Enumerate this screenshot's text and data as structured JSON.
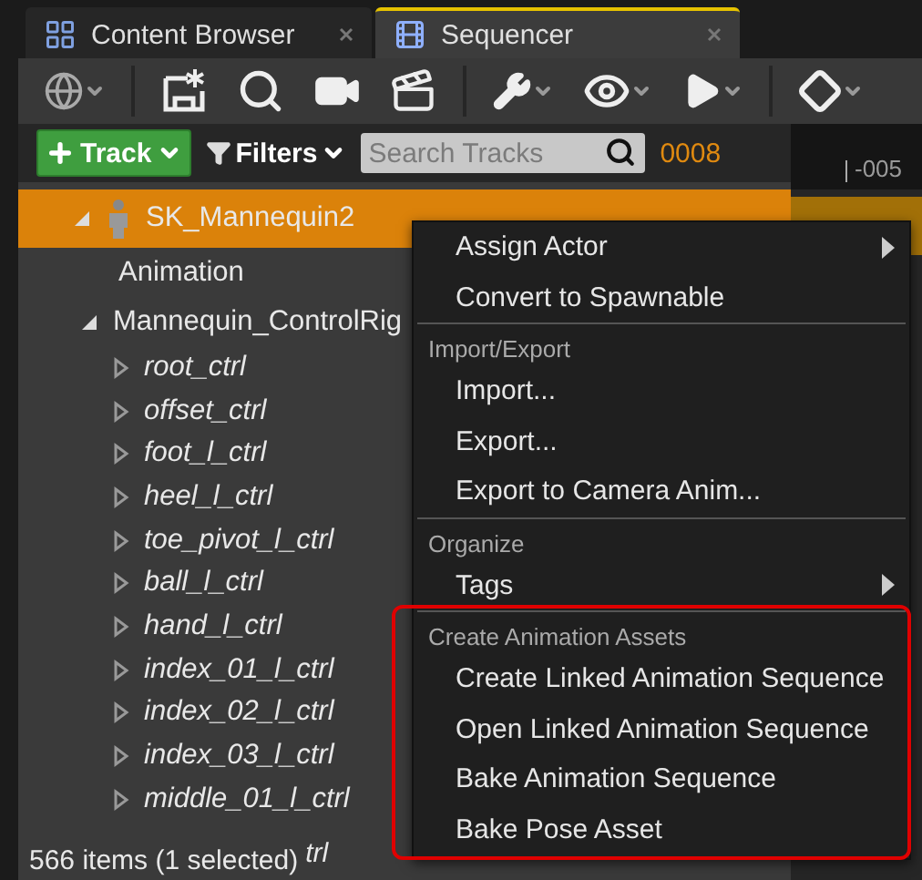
{
  "tabs": [
    {
      "label": "Content Browser",
      "selected": false
    },
    {
      "label": "Sequencer",
      "selected": true
    }
  ],
  "track_bar": {
    "add_button": "Track",
    "filters": "Filters",
    "search": {
      "placeholder": "Search Tracks"
    },
    "frame": "0008"
  },
  "timeline": {
    "tick": "-005"
  },
  "tree": [
    {
      "label": "SK_Mannequin2",
      "selected": true,
      "expanded": true,
      "italic": false,
      "children": [
        {
          "label": "Animation",
          "selected": false,
          "italic": false
        },
        {
          "label": "Mannequin_ControlRig",
          "selected": false,
          "expanded": true,
          "italic": false,
          "children": [
            {
              "label": "root_ctrl",
              "selected": false,
              "expanded": false,
              "italic": true
            },
            {
              "label": "offset_ctrl",
              "selected": false,
              "expanded": false,
              "italic": true
            },
            {
              "label": "foot_l_ctrl",
              "selected": false,
              "expanded": false,
              "italic": true
            },
            {
              "label": "heel_l_ctrl",
              "selected": false,
              "expanded": false,
              "italic": true
            },
            {
              "label": "toe_pivot_l_ctrl",
              "selected": false,
              "expanded": false,
              "italic": true
            },
            {
              "label": "ball_l_ctrl",
              "selected": false,
              "expanded": false,
              "italic": true
            },
            {
              "label": "hand_l_ctrl",
              "selected": false,
              "expanded": false,
              "italic": true
            },
            {
              "label": "index_01_l_ctrl",
              "selected": false,
              "expanded": false,
              "italic": true
            },
            {
              "label": "index_02_l_ctrl",
              "selected": false,
              "expanded": false,
              "italic": true
            },
            {
              "label": "index_03_l_ctrl",
              "selected": false,
              "expanded": false,
              "italic": true
            },
            {
              "label": "middle_01_l_ctrl",
              "selected": false,
              "expanded": false,
              "italic": true
            }
          ]
        }
      ]
    }
  ],
  "status": {
    "text": "566 items (1 selected)",
    "hidden_row_tail": "trl"
  },
  "context_menu": {
    "sections": [
      {
        "items": [
          {
            "label": "Assign Actor",
            "submenu": true
          },
          {
            "label": "Convert to Spawnable",
            "submenu": false
          }
        ]
      },
      {
        "heading": "Import/Export",
        "items": [
          {
            "label": "Import...",
            "submenu": false
          },
          {
            "label": "Export...",
            "submenu": false
          },
          {
            "label": "Export to Camera Anim...",
            "submenu": false
          }
        ]
      },
      {
        "heading": "Organize",
        "items": [
          {
            "label": "Tags",
            "submenu": true
          }
        ]
      },
      {
        "heading": "Create Animation Assets",
        "highlighted": true,
        "items": [
          {
            "label": "Create Linked Animation Sequence",
            "submenu": false
          },
          {
            "label": "Open Linked Animation Sequence",
            "submenu": false
          },
          {
            "label": "Bake Animation Sequence",
            "submenu": false
          },
          {
            "label": "Bake Pose Asset",
            "submenu": false
          }
        ]
      }
    ]
  }
}
